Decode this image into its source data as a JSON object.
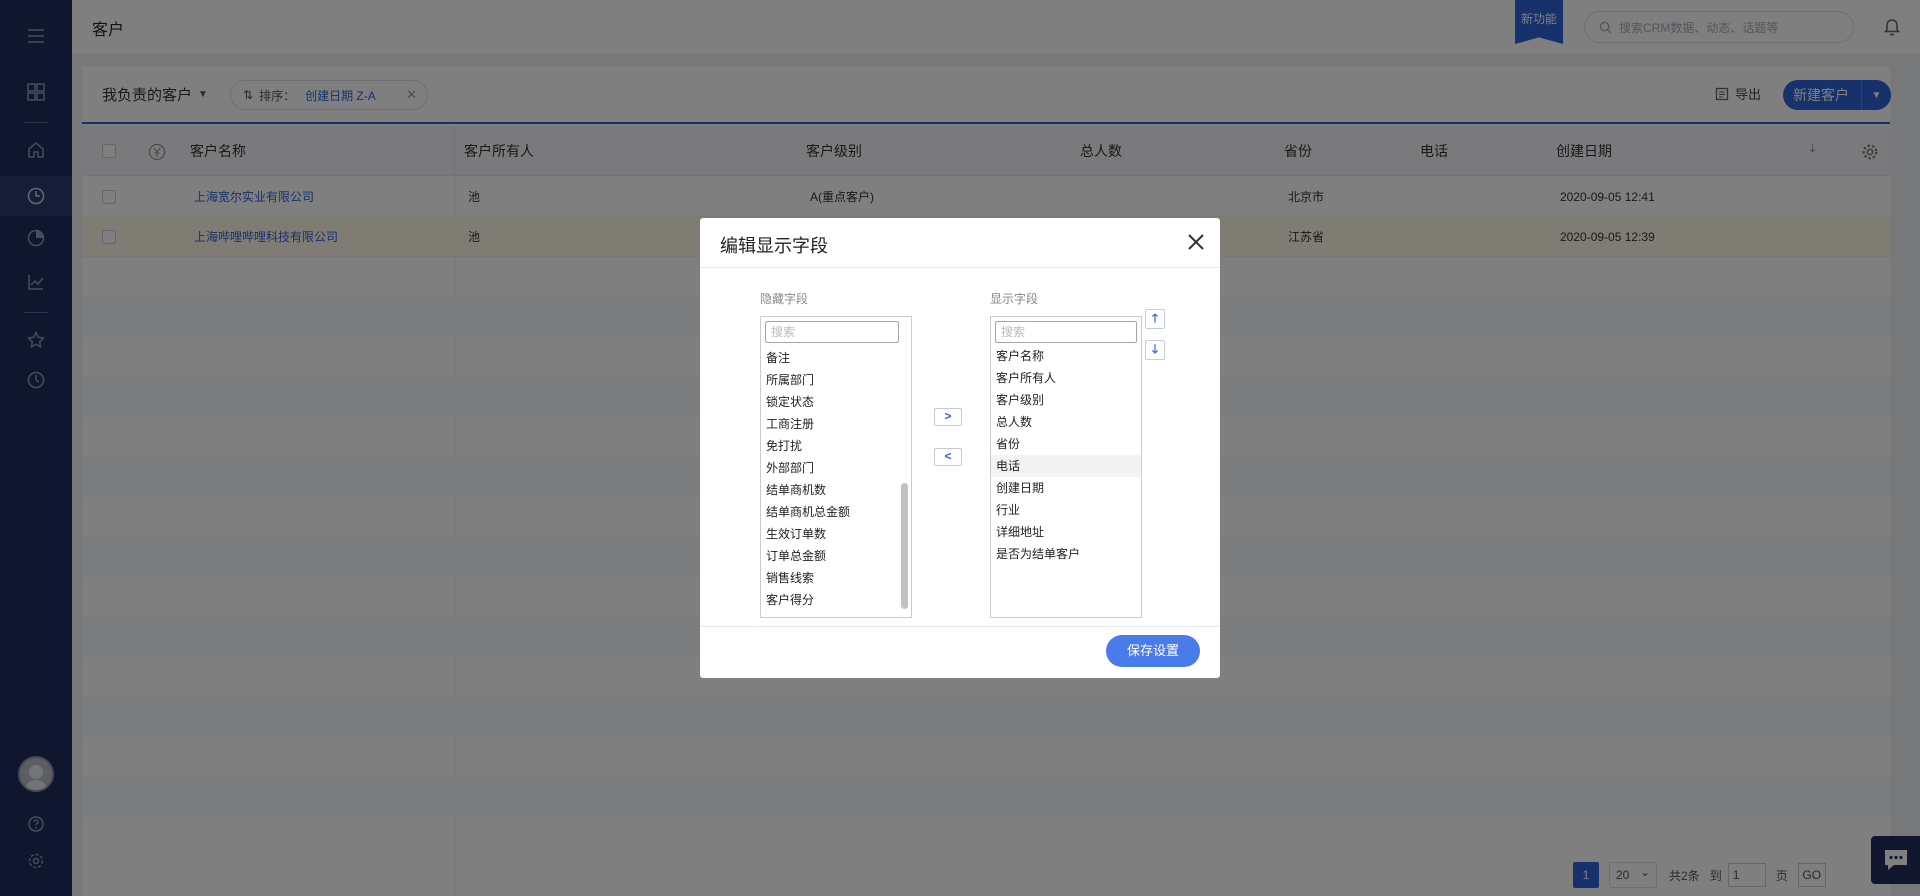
{
  "app": {
    "page_title": "客户",
    "new_feature_badge": "新功能",
    "search_placeholder": "搜索CRM数据、动态、话题等",
    "accent_color": "#2f63d8",
    "sidebar_color": "#1f2d5a"
  },
  "sidebar": {
    "icons": [
      "menu-icon",
      "dashboard-icon",
      "home-icon",
      "clock-pie-icon",
      "pie-chart-icon",
      "line-chart-icon",
      "star-icon",
      "history-icon",
      "help-icon",
      "settings-icon"
    ]
  },
  "toolbar": {
    "view_label": "我负责的客户",
    "sort_prefix": "排序：",
    "sort_value": "创建日期 Z-A",
    "export_label": "导出",
    "new_label": "新建客户"
  },
  "table": {
    "headers": {
      "name": "客户名称",
      "owner": "客户所有人",
      "level": "客户级别",
      "headcount": "总人数",
      "province": "省份",
      "phone": "电话",
      "created": "创建日期"
    },
    "rows": [
      {
        "name": "上海宽尔实业有限公司",
        "owner": "池",
        "level": "A(重点客户)",
        "headcount": "",
        "province": "北京市",
        "phone": "",
        "created": "2020-09-05 12:41"
      },
      {
        "name": "上海哔哩哔哩科技有限公司",
        "owner": "池",
        "level": "",
        "headcount": "",
        "province": "江苏省",
        "phone": "",
        "created": "2020-09-05 12:39"
      }
    ]
  },
  "pagination": {
    "current": "1",
    "page_size": "20",
    "total": "共2条",
    "goto_label": "到",
    "goto_value": "1",
    "page_unit": "页",
    "go_label": "GO"
  },
  "modal": {
    "title": "编辑显示字段",
    "hidden_title": "隐藏字段",
    "shown_title": "显示字段",
    "search_placeholder": "搜索",
    "hidden_fields": [
      "备注",
      "所属部门",
      "锁定状态",
      "工商注册",
      "免打扰",
      "外部部门",
      "结单商机数",
      "结单商机总金额",
      "生效订单数",
      "订单总金额",
      "销售线索",
      "客户得分"
    ],
    "shown_fields": [
      "客户名称",
      "客户所有人",
      "客户级别",
      "总人数",
      "省份",
      "电话",
      "创建日期",
      "行业",
      "详细地址",
      "是否为结单客户"
    ],
    "selected_shown_field": "电话",
    "move_right": ">",
    "move_left": "<",
    "move_up": "🡑",
    "move_down": "🡓",
    "save_label": "保存设置"
  }
}
